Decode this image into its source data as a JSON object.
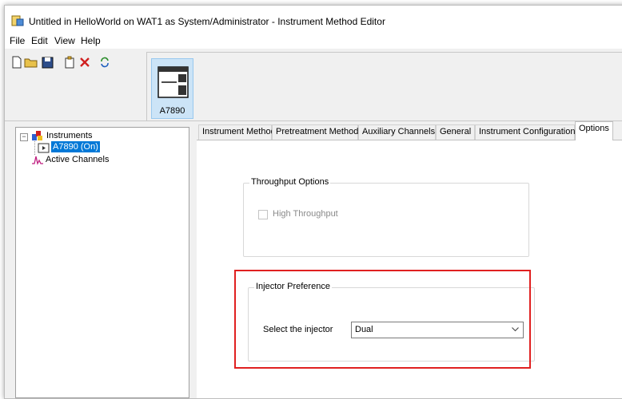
{
  "window": {
    "title": "Untitled in HelloWorld on WAT1 as System/Administrator - Instrument Method Editor",
    "app_icon": "lock-document-icon"
  },
  "menu": [
    "File",
    "Edit",
    "View",
    "Help"
  ],
  "toolbar": {
    "buttons": [
      "new-document-icon",
      "open-folder-icon",
      "save-icon",
      "paste-icon",
      "delete-icon",
      "refresh-icon"
    ]
  },
  "instrument_button": {
    "label": "A7890",
    "icon": "gc-instrument-icon"
  },
  "tree": {
    "root": "Instruments",
    "child": "A7890 (On)",
    "second": "Active Channels"
  },
  "tabs": [
    "Instrument Method",
    "Pretreatment Method",
    "Auxiliary Channels",
    "General",
    "Instrument Configuration",
    "Options"
  ],
  "active_tab": "Options",
  "throughput": {
    "title": "Throughput Options",
    "checkbox_label": "High Throughput",
    "checked": false,
    "enabled": false
  },
  "injector": {
    "title": "Injector Preference",
    "select_label": "Select the injector",
    "value": "Dual"
  },
  "colors": {
    "highlight": "#e02020",
    "selection": "#0078d7",
    "instrument_button_bg": "#cce4f7"
  }
}
